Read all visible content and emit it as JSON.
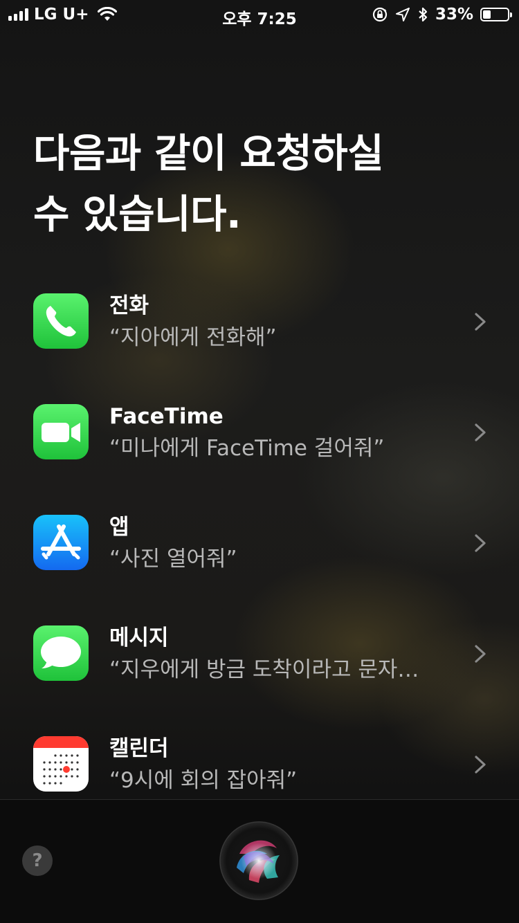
{
  "status_bar": {
    "carrier": "LG U+",
    "time": "오후 7:25",
    "battery_percent_label": "33%",
    "battery_level": 0.33,
    "icons": [
      "signal-bars-icon",
      "wifi-icon",
      "orientation-lock-icon",
      "location-arrow-icon",
      "bluetooth-icon",
      "battery-icon"
    ]
  },
  "heading": {
    "line1": "다음과 같이 요청하실",
    "line2": "수 있습니다."
  },
  "suggestions": [
    {
      "name": "전화",
      "example": "“지아에게 전화해”",
      "icon": "phone-app-icon",
      "color": "#28c840"
    },
    {
      "name": "FaceTime",
      "example": "“미나에게 FaceTime 걸어줘”",
      "icon": "facetime-app-icon",
      "color": "#28c840"
    },
    {
      "name": "앱",
      "example": "“사진 열어줘”",
      "icon": "app-store-icon",
      "color": "#1a8cff"
    },
    {
      "name": "메시지",
      "example": "“지우에게 방금 도착이라고 문자…",
      "icon": "messages-app-icon",
      "color": "#28c840"
    },
    {
      "name": "캘린더",
      "example": "“9시에 회의 잡아줘”",
      "icon": "calendar-app-icon",
      "color": "#ffffff"
    }
  ],
  "bottom_bar": {
    "help_label": "?",
    "siri_icon": "siri-orb-icon"
  }
}
